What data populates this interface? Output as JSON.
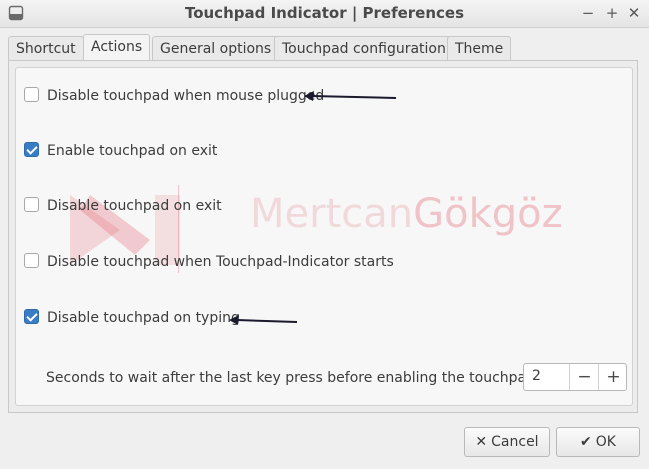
{
  "window": {
    "title": "Touchpad Indicator | Preferences",
    "minimize_glyph": "−",
    "maximize_glyph": "+",
    "close_glyph": "✕"
  },
  "tabs": [
    {
      "label": "Shortcut",
      "active": false
    },
    {
      "label": "Actions",
      "active": true
    },
    {
      "label": "General options",
      "active": false
    },
    {
      "label": "Touchpad configuration",
      "active": false
    },
    {
      "label": "Theme",
      "active": false
    }
  ],
  "options": [
    {
      "label": "Disable touchpad when mouse plugged",
      "checked": false
    },
    {
      "label": "Enable touchpad on exit",
      "checked": true
    },
    {
      "label": "Disable touchpad on exit",
      "checked": false
    },
    {
      "label": "Disable touchpad when Touchpad-Indicator starts",
      "checked": false
    },
    {
      "label": "Disable touchpad on typing",
      "checked": true
    }
  ],
  "delay": {
    "label": "Seconds to wait after the last key press before enabling the touchpad:",
    "value": "2",
    "decrement": "−",
    "increment": "+"
  },
  "watermark": {
    "part1": "Mertcan",
    "part2": "Gökgöz"
  },
  "buttons": {
    "cancel_label": "Cancel",
    "cancel_icon": "✕",
    "ok_label": "OK",
    "ok_icon": "✔"
  },
  "colors": {
    "accent": "#3a7dc7",
    "watermark": "#e28c94"
  }
}
